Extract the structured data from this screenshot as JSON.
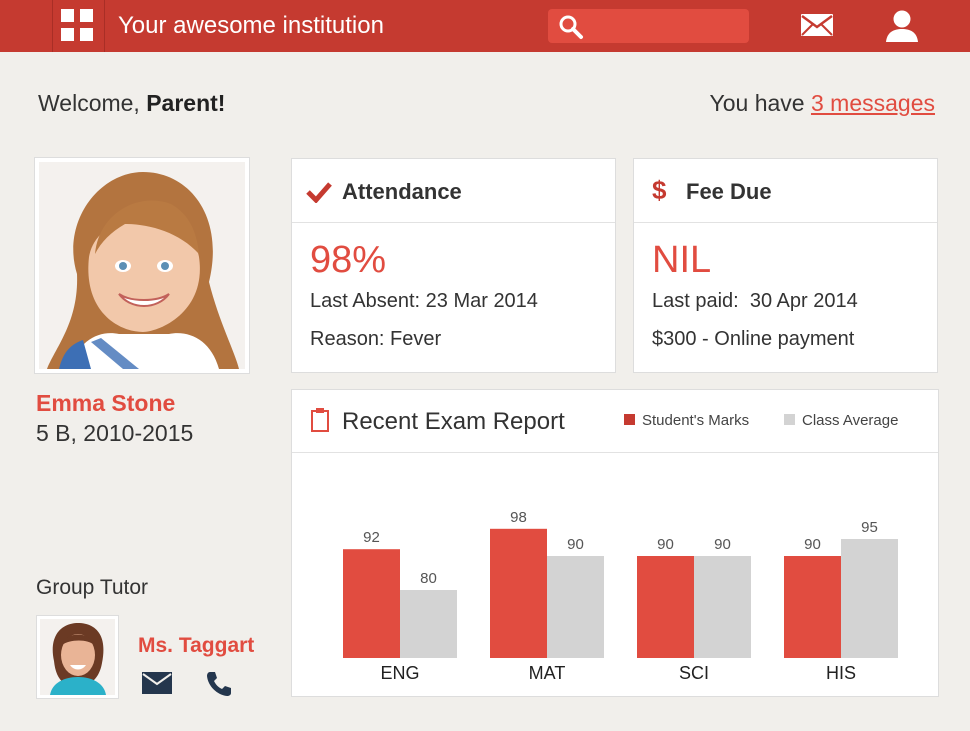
{
  "header": {
    "app_title": "Your awesome institution",
    "search_placeholder": "",
    "menu_icon": "grid-menu-icon",
    "mail_icon": "envelope-icon",
    "user_icon": "user-icon"
  },
  "welcome": {
    "greeting": "Welcome, ",
    "name": "Parent!",
    "messages_prefix": "You have ",
    "messages_link": "3 messages"
  },
  "student": {
    "name": "Emma Stone",
    "class_info": "5 B, 2010-2015"
  },
  "tutor": {
    "label": "Group Tutor",
    "name": "Ms. Taggart"
  },
  "attendance": {
    "title": "Attendance",
    "icon": "check-icon",
    "value": "98%",
    "last_absent": "Last Absent: 23 Mar 2014",
    "reason": "Reason: Fever"
  },
  "fee": {
    "title": "Fee Due",
    "icon": "dollar-icon",
    "value": "NIL",
    "last_paid": "Last paid:  30 Apr 2014",
    "payment": "$300 - Online payment"
  },
  "exam": {
    "title": "Recent Exam Report",
    "icon": "clipboard-icon"
  },
  "colors": {
    "accent": "#e14c40",
    "header": "#c53a30",
    "class_avg": "#d3d3d3"
  },
  "chart_data": {
    "type": "bar",
    "categories": [
      "ENG",
      "MAT",
      "SCI",
      "HIS"
    ],
    "series": [
      {
        "name": "Student's Marks",
        "values": [
          92,
          98,
          90,
          90
        ],
        "color": "#e14c40"
      },
      {
        "name": "Class Average",
        "values": [
          80,
          90,
          90,
          95
        ],
        "color": "#d3d3d3"
      }
    ],
    "ylim": [
      60,
      100
    ]
  }
}
